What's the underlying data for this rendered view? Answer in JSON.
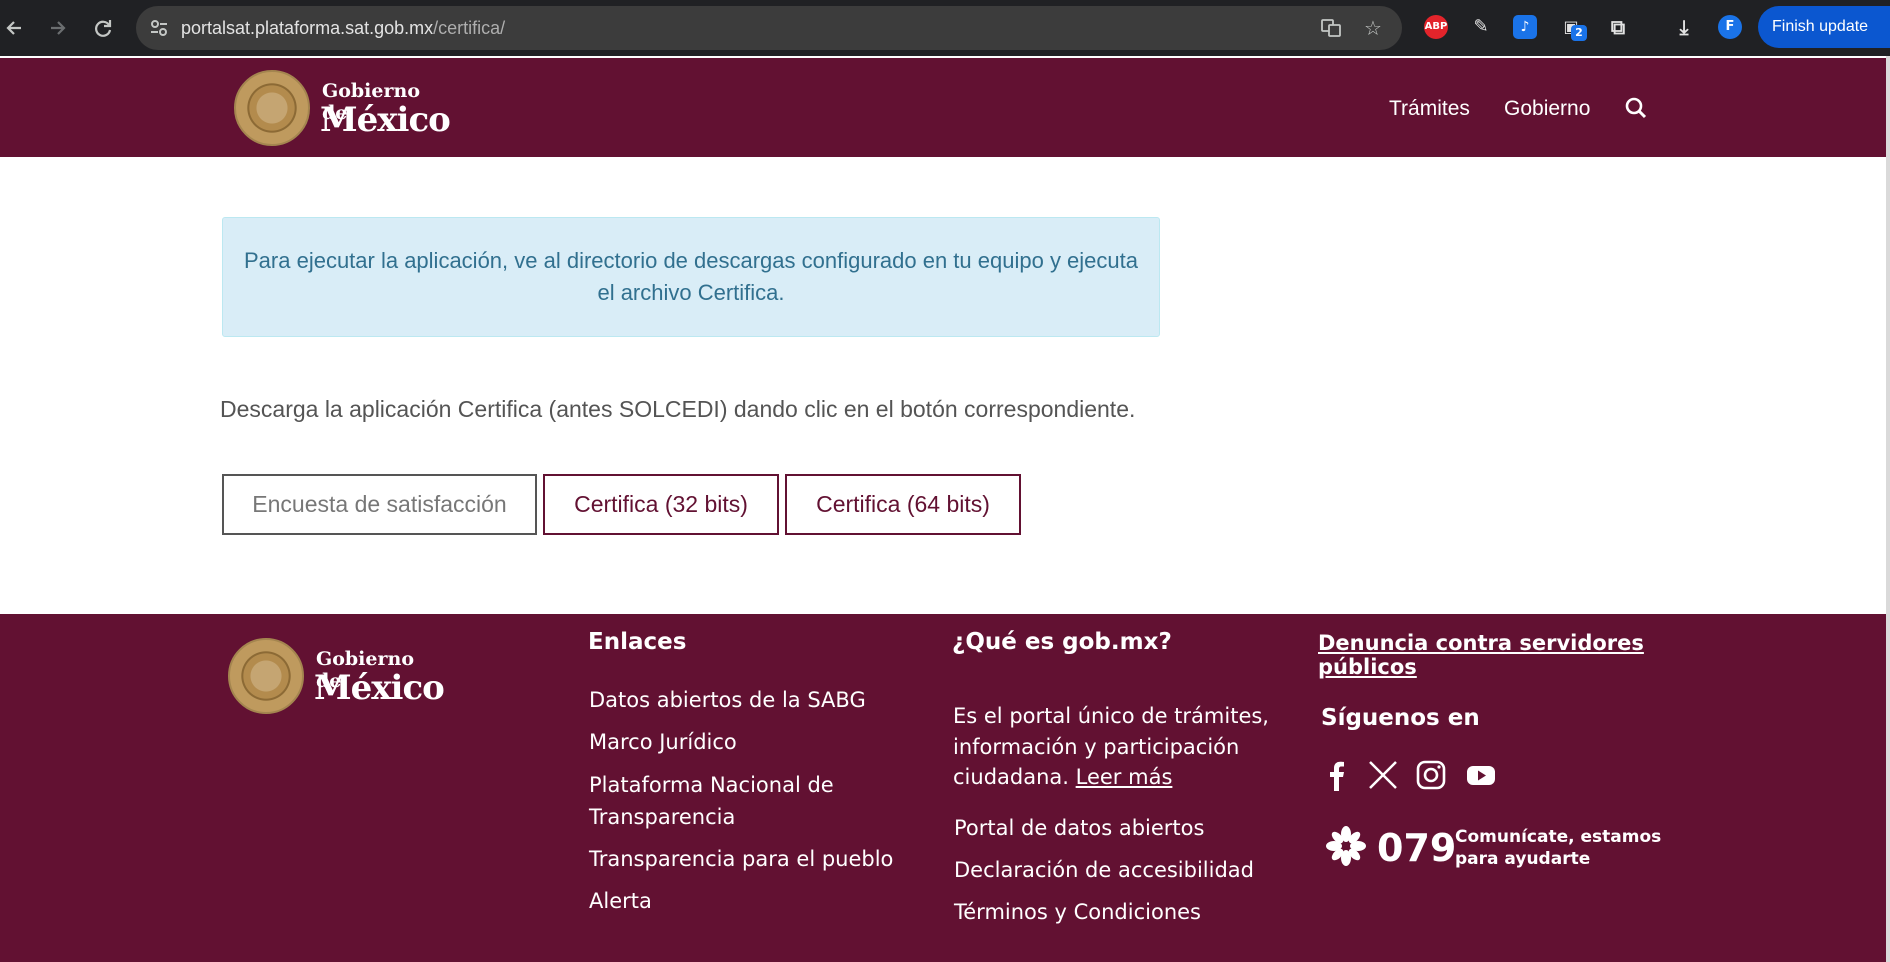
{
  "browser": {
    "url_host": "portalsat.plataforma.sat.gob.mx",
    "url_path": "/certifica/",
    "finish_update_label": "Finish update",
    "profile_initial": "F",
    "ext_abp_label": "ABP",
    "ext_badge_count": "2"
  },
  "header": {
    "logo_small": "Gobierno de",
    "logo_big": "México",
    "nav": [
      "Trámites",
      "Gobierno"
    ]
  },
  "main": {
    "alert_line1": "Para ejecutar la aplicación, ve al directorio de descargas configurado en tu equipo y ejecuta",
    "alert_line2": "el archivo Certifica.",
    "description": "Descarga la aplicación Certifica (antes SOLCEDI) dando clic en el botón correspondiente.",
    "buttons": {
      "survey": "Encuesta de satisfacción",
      "cert32": "Certifica (32 bits)",
      "cert64": "Certifica (64 bits)"
    }
  },
  "footer": {
    "logo_small": "Gobierno de",
    "logo_big": "México",
    "links_title": "Enlaces",
    "links": [
      "Datos abiertos de la SABG",
      "Marco Jurídico",
      "Plataforma Nacional de",
      "Transparencia",
      "Transparencia para el pueblo",
      "Alerta"
    ],
    "about_title": "¿Qué es gob.mx?",
    "about_text1": "Es el portal único de trámites,",
    "about_text2": "información y participación",
    "about_text3": "ciudadana.",
    "about_more": "Leer más",
    "about_links": [
      "Portal de datos abiertos",
      "Declaración de accesibilidad",
      "Términos y Condiciones"
    ],
    "report_line1": "Denuncia contra servidores",
    "report_line2": "públicos",
    "follow_title": "Síguenos en",
    "phone": "079",
    "phone_cta1": "Comunícate, estamos",
    "phone_cta2": "para ayudarte"
  },
  "colors": {
    "brand_wine": "#621132",
    "alert_bg": "#d9edf7",
    "alert_text": "#31708f",
    "chrome_bg": "#202124"
  }
}
